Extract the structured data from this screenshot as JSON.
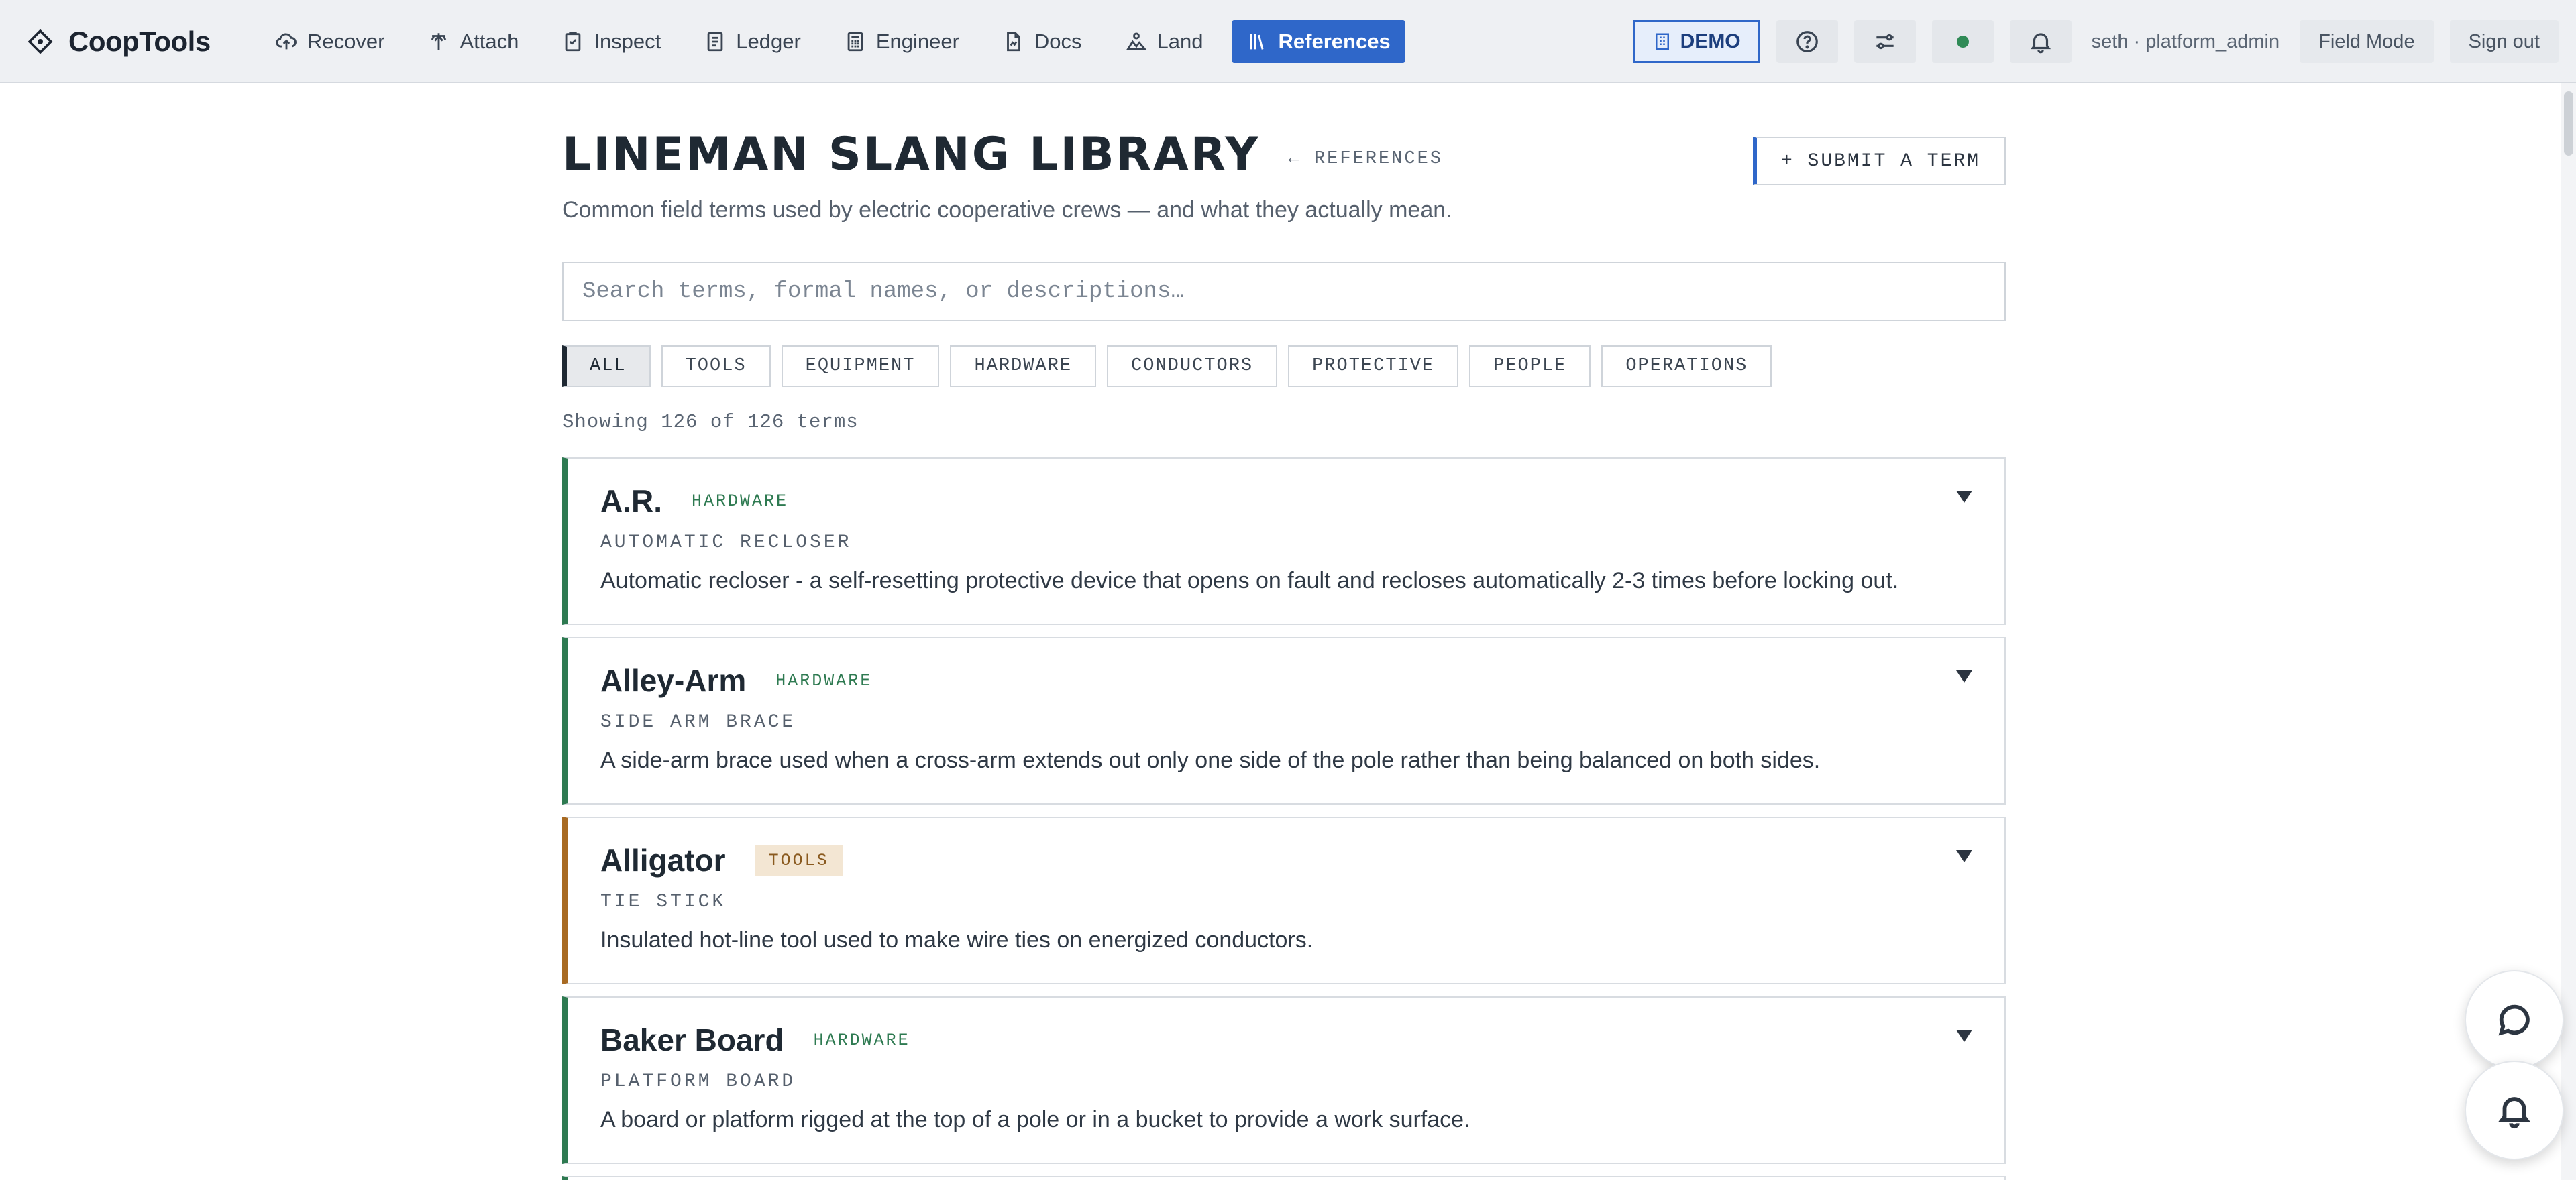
{
  "brand": {
    "name": "CoopTools"
  },
  "nav": [
    {
      "label": "Recover",
      "icon": "cloud-upload-icon"
    },
    {
      "label": "Attach",
      "icon": "pole-icon"
    },
    {
      "label": "Inspect",
      "icon": "clipboard-icon"
    },
    {
      "label": "Ledger",
      "icon": "ledger-icon"
    },
    {
      "label": "Engineer",
      "icon": "calculator-icon"
    },
    {
      "label": "Docs",
      "icon": "document-icon"
    },
    {
      "label": "Land",
      "icon": "land-icon"
    },
    {
      "label": "References",
      "icon": "books-icon",
      "active": true
    }
  ],
  "toolbar": {
    "demo_label": "DEMO",
    "user": "seth · platform_admin",
    "field_mode": "Field Mode",
    "sign_out": "Sign out",
    "status_color": "#2f8a56"
  },
  "page": {
    "title": "LINEMAN SLANG LIBRARY",
    "back_link": "← REFERENCES",
    "submit": "+ SUBMIT A TERM",
    "subtitle": "Common field terms used by electric cooperative crews — and what they actually mean.",
    "search_placeholder": "Search terms, formal names, or descriptions…",
    "count_text": "Showing 126 of 126 terms"
  },
  "filters": [
    "ALL",
    "TOOLS",
    "EQUIPMENT",
    "HARDWARE",
    "CONDUCTORS",
    "PROTECTIVE",
    "PEOPLE",
    "OPERATIONS"
  ],
  "active_filter": "ALL",
  "terms": [
    {
      "term": "A.R.",
      "category": "HARDWARE",
      "formal": "AUTOMATIC RECLOSER",
      "description": "Automatic recloser - a self-resetting protective device that opens on fault and recloses automatically 2-3 times before locking out."
    },
    {
      "term": "Alley-Arm",
      "category": "HARDWARE",
      "formal": "SIDE ARM BRACE",
      "description": "A side-arm brace used when a cross-arm extends out only one side of the pole rather than being balanced on both sides."
    },
    {
      "term": "Alligator",
      "category": "TOOLS",
      "formal": "TIE STICK",
      "description": "Insulated hot-line tool used to make wire ties on energized conductors."
    },
    {
      "term": "Baker Board",
      "category": "HARDWARE",
      "formal": "PLATFORM BOARD",
      "description": "A board or platform rigged at the top of a pole or in a bucket to provide a work surface."
    }
  ],
  "colors": {
    "accent": "#2f67c9",
    "hardware": "#2e7a51",
    "tools": "#a86a22"
  }
}
